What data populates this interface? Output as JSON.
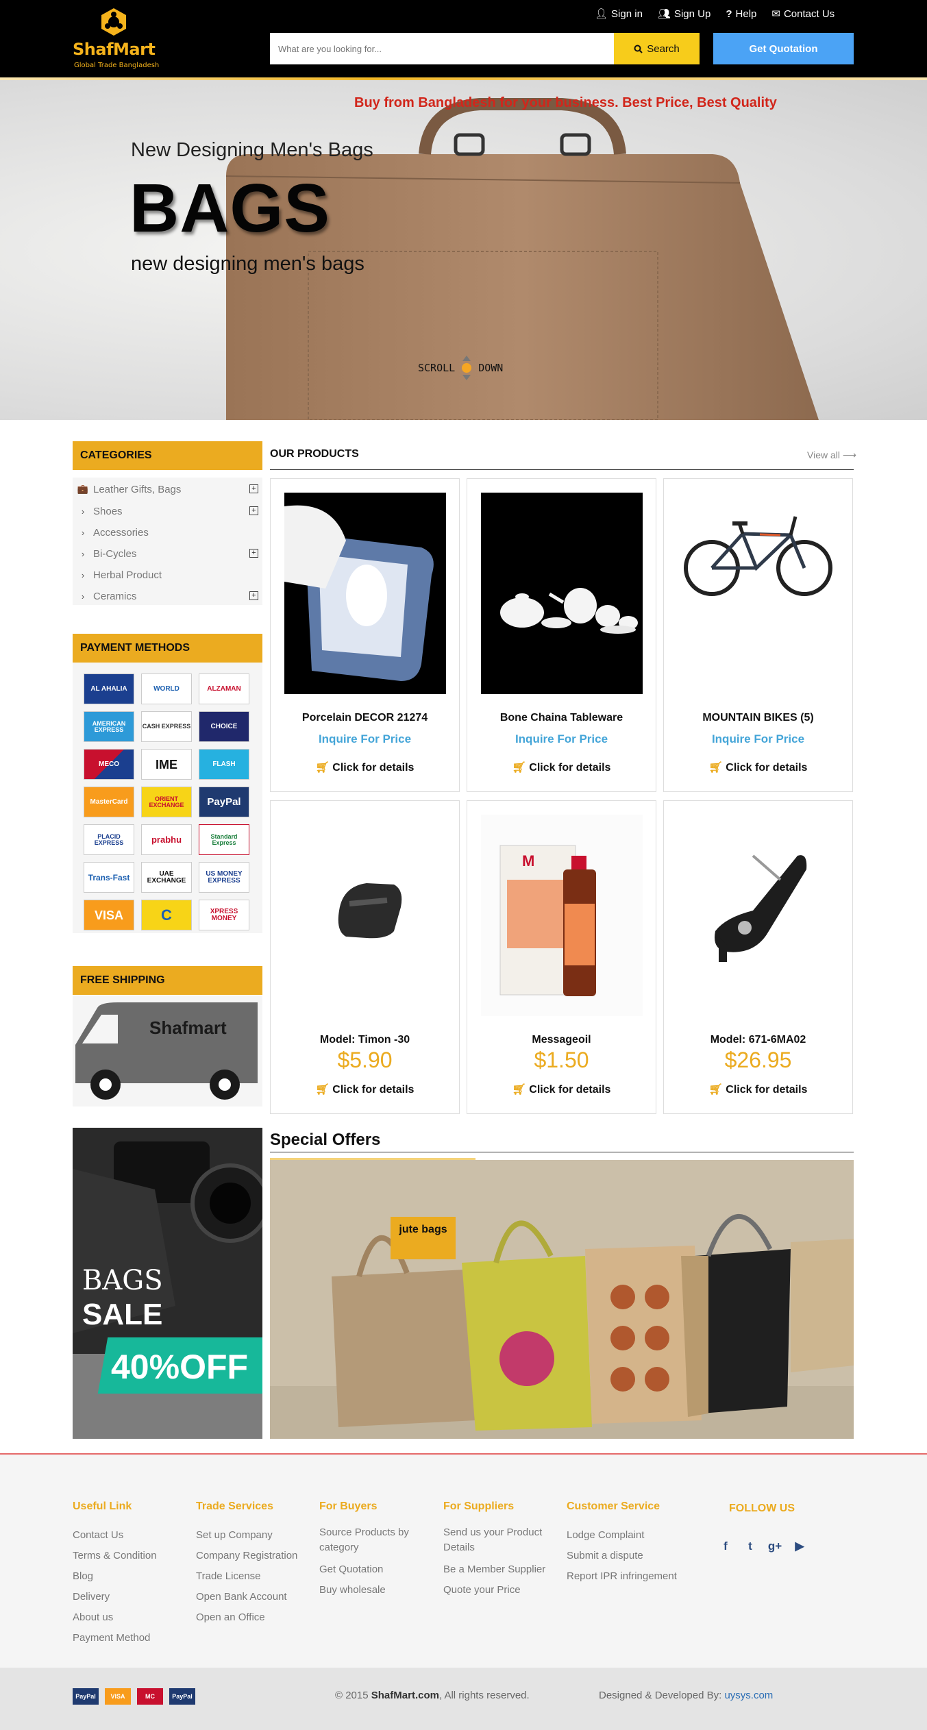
{
  "header": {
    "logo_title": "ShafMart",
    "logo_subtitle": "Global Trade Bangladesh",
    "links": [
      {
        "icon": "user-icon",
        "label": "Sign in"
      },
      {
        "icon": "user-plus-icon",
        "label": "Sign Up"
      },
      {
        "icon": "question-icon",
        "label": "Help"
      },
      {
        "icon": "envelope-icon",
        "label": "Contact Us"
      }
    ],
    "search_placeholder": "What are you looking for...",
    "search_label": "Search",
    "quotation_label": "Get Quotation"
  },
  "hero": {
    "tagline": "Buy from Bangladesh for your business. Best Price, Best Quality",
    "subtitle": "New Designing Men's Bags",
    "title": "BAGS",
    "description": "new designing men's bags",
    "scroll_left": "SCROLL",
    "scroll_right": "DOWN"
  },
  "sidebar": {
    "categories_title": "CATEGORIES",
    "categories": [
      {
        "label": "Leather Gifts, Bags",
        "expandable": true
      },
      {
        "label": "Shoes",
        "expandable": true
      },
      {
        "label": "Accessories",
        "expandable": false
      },
      {
        "label": "Bi-Cycles",
        "expandable": true
      },
      {
        "label": "Herbal Product",
        "expandable": false
      },
      {
        "label": "Ceramics",
        "expandable": true
      }
    ],
    "payment_title": "PAYMENT METHODS",
    "payment_methods": [
      "AL AHALIA",
      "WORLD",
      "ALZAMAN",
      "AMERICAN EXPRESS",
      "CASH EXPRESS",
      "CHOICE",
      "MECO",
      "IME",
      "FLASH",
      "MasterCard",
      "ORIENT EXCHANGE",
      "PayPal",
      "PLACID EXPRESS",
      "prabhu",
      "Standard Express",
      "Trans-Fast",
      "UAE EXCHANGE",
      "US MONEY EXPRESS",
      "VISA",
      "C",
      "XPRESS MONEY"
    ],
    "shipping_title": "FREE SHIPPING",
    "shipping_van_text": "Shafmart"
  },
  "products": {
    "title": "OUR PRODUCTS",
    "view_all": "View all",
    "details_label": "Click for details",
    "items": [
      {
        "name": "Porcelain DECOR 21274",
        "price": "Inquire For Price",
        "inquire": true
      },
      {
        "name": "Bone Chaina Tableware",
        "price": "Inquire For Price",
        "inquire": true
      },
      {
        "name": "MOUNTAIN BIKES (5)",
        "price": "Inquire For Price",
        "inquire": true
      },
      {
        "name": "Model: Timon -30",
        "price": "$5.90",
        "inquire": false
      },
      {
        "name": "Messageoil",
        "price": "$1.50",
        "inquire": false
      },
      {
        "name": "Model: 671-6MA02",
        "price": "$26.95",
        "inquire": false
      }
    ]
  },
  "special": {
    "title": "Special Offers",
    "banner_line1": "BAGS",
    "banner_line2": "SALE",
    "banner_discount": "40%OFF",
    "offer_label": "jute bags"
  },
  "footer": {
    "columns": [
      {
        "title": "Useful Link",
        "links": [
          "Contact Us",
          "Terms & Condition",
          "Blog",
          "Delivery",
          "About us",
          "Payment Method"
        ]
      },
      {
        "title": "Trade Services",
        "links": [
          "Set up Company",
          "Company Registration",
          "Trade License",
          "Open Bank Account",
          "Open an Office"
        ]
      },
      {
        "title": "For Buyers",
        "links": [
          "Source Products by category",
          "Get Quotation",
          "Buy wholesale"
        ]
      },
      {
        "title": "For Suppliers",
        "links": [
          "Send us your Product Details",
          "Be a Member Supplier",
          "Quote your Price"
        ]
      },
      {
        "title": "Customer Service",
        "links": [
          "Lodge Complaint",
          "Submit a dispute",
          "Report IPR infringement"
        ]
      }
    ],
    "follow_title": "FOLLOW US",
    "social": [
      {
        "icon": "facebook-icon",
        "glyph": "f"
      },
      {
        "icon": "twitter-icon",
        "glyph": "t"
      },
      {
        "icon": "google-plus-icon",
        "glyph": "g+"
      },
      {
        "icon": "youtube-icon",
        "glyph": "▶"
      }
    ],
    "copyright_prefix": "© 2015 ",
    "copyright_brand": "ShafMart.com",
    "copyright_suffix": ", All rights reserved.",
    "designed_prefix": "Designed & Developed By: ",
    "designed_link": "uysys.com",
    "payment_icons": [
      "PayPal",
      "VISA",
      "MC",
      "PayPal"
    ]
  },
  "colors": {
    "accent": "#ebab20",
    "price": "#ebab20",
    "inquire": "#44a5d8",
    "quote_button": "#4ba3f5",
    "search_button": "#f7cc1b",
    "tagline": "#d1261b"
  }
}
